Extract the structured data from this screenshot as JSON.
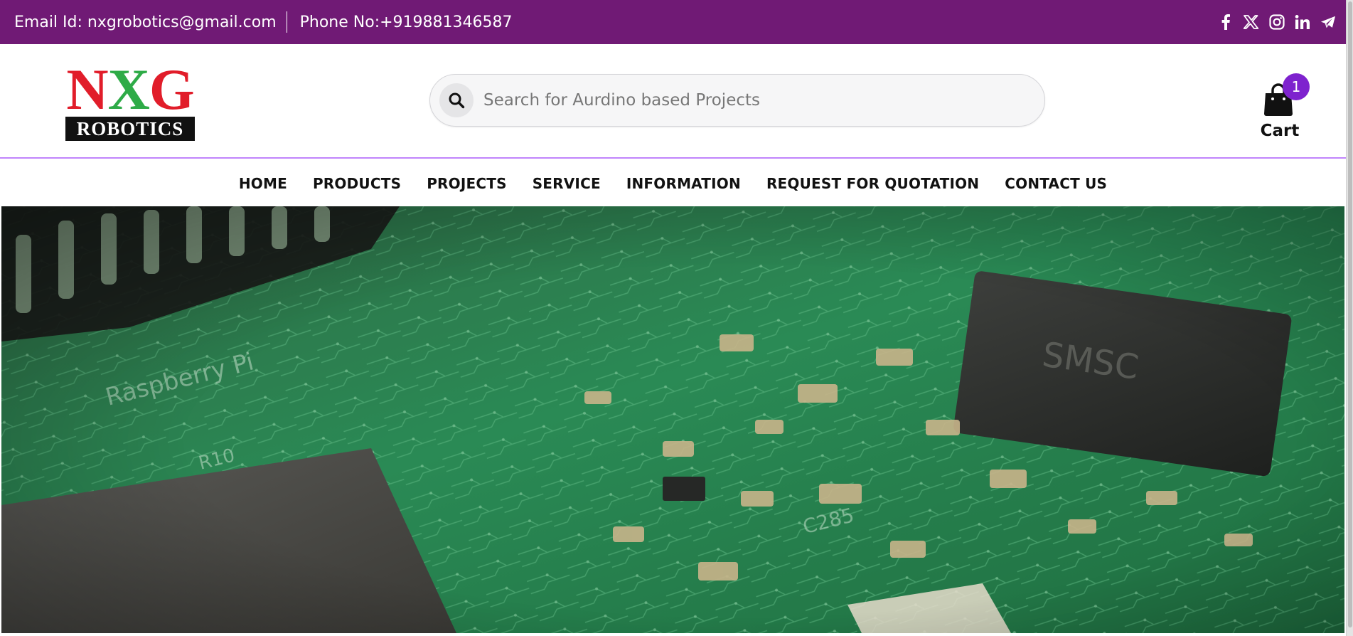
{
  "topbar": {
    "email_text": "Email Id: nxgrobotics@gmail.com",
    "phone_text": "Phone No:+919881346587",
    "socials": [
      "facebook-icon",
      "x-icon",
      "instagram-icon",
      "linkedin-icon",
      "telegram-icon"
    ]
  },
  "brand": {
    "logo_top": [
      "N",
      "X",
      "G"
    ],
    "logo_bottom": "ROBOTICS",
    "colors": {
      "N": "#e11d2a",
      "X": "#2eab47",
      "G": "#e11d2a"
    }
  },
  "search": {
    "placeholder": "Search for Aurdino based Projects",
    "value": ""
  },
  "cart": {
    "label": "Cart",
    "count": "1"
  },
  "nav": {
    "items": [
      "HOME",
      "PRODUCTS",
      "PROJECTS",
      "SERVICE",
      "INFORMATION",
      "REQUEST FOR QUOTATION",
      "CONTACT US"
    ]
  },
  "hero": {
    "image": "circuit-board-photo"
  },
  "theme": {
    "primary": "#701a75",
    "accent": "#7e22ce",
    "divider": "#c084fc"
  }
}
